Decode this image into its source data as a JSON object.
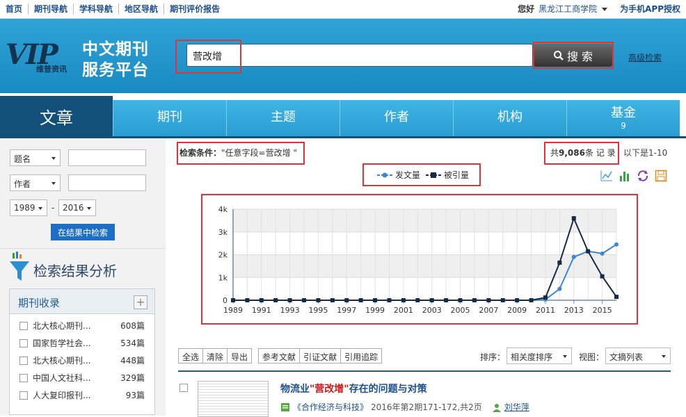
{
  "topbar": {
    "links": [
      "首页",
      "期刊导航",
      "学科导航",
      "地区导航",
      "期刊评价报告"
    ],
    "greeting": "您好",
    "institution": "黑龙江工商学院",
    "app_link": "为手机APP授权"
  },
  "header": {
    "logo_text": "VIP",
    "logo_sub": "维普资讯",
    "brand_line1": "中文期刊",
    "brand_line2": "服务平台",
    "search_value": "营改增",
    "search_button": "搜 索",
    "advanced_link": "高级检索"
  },
  "tabs": [
    {
      "label": "文章",
      "count": ""
    },
    {
      "label": "期刊",
      "count": ""
    },
    {
      "label": "主题",
      "count": ""
    },
    {
      "label": "作者",
      "count": ""
    },
    {
      "label": "机构",
      "count": ""
    },
    {
      "label": "基金",
      "count": "9"
    }
  ],
  "sidebar": {
    "field1": "题名",
    "field2": "作者",
    "year_from": "1989",
    "year_to": "2016",
    "dash": "-",
    "search_in_results": "在结果中检索",
    "analysis_title": "检索结果分析",
    "panel_title": "期刊收录",
    "journals": [
      {
        "name": "北大核心期刊...",
        "count": "608篇"
      },
      {
        "name": "国家哲学社会...",
        "count": "534篇"
      },
      {
        "name": "北大核心期刊...",
        "count": "448篇"
      },
      {
        "name": "中国人文社科...",
        "count": "329篇"
      },
      {
        "name": "人大复印报刊...",
        "count": "93篇"
      }
    ]
  },
  "main": {
    "cond_label": "检索条件：",
    "cond_value": "\"任意字段=营改增 \"",
    "total_prefix": "共",
    "total_count": "9,086",
    "total_suffix": "条 记 录",
    "range": "以下是1-10",
    "legend_pub": "发文量",
    "legend_cite": "被引量",
    "toolbar": [
      "全选",
      "清除",
      "导出"
    ],
    "toolbar2": [
      "参考文献",
      "引证文献",
      "引用追踪"
    ],
    "sort_label": "排序：",
    "sort_value": "相关度排序",
    "view_label": "视图：",
    "view_value": "文摘列表",
    "result": {
      "title_before": "物流业",
      "title_hl": "\"营改增\"",
      "title_after": "存在的问题与对策",
      "source": "《合作经济与科技》",
      "meta": "2016年第2期171-172,共2页",
      "author": "刘华萍"
    }
  },
  "chart_data": {
    "type": "line",
    "x": [
      1989,
      1990,
      1991,
      1992,
      1993,
      1994,
      1995,
      1996,
      1997,
      1998,
      1999,
      2000,
      2001,
      2002,
      2003,
      2004,
      2005,
      2006,
      2007,
      2008,
      2009,
      2010,
      2011,
      2012,
      2013,
      2014,
      2015,
      2016
    ],
    "x_ticks": [
      "1989",
      "1991",
      "1993",
      "1995",
      "1997",
      "1999",
      "2001",
      "2003",
      "2005",
      "2007",
      "2009",
      "2011",
      "2013",
      "2015"
    ],
    "y_ticks": [
      "0",
      "1k",
      "2k",
      "3k",
      "4k"
    ],
    "ylim": [
      0,
      4000
    ],
    "series": [
      {
        "name": "发文量",
        "color": "#3a86d4",
        "values": [
          0,
          0,
          0,
          0,
          0,
          0,
          0,
          0,
          0,
          0,
          0,
          0,
          0,
          0,
          0,
          0,
          0,
          0,
          0,
          0,
          0,
          0,
          30,
          500,
          1900,
          2150,
          2050,
          2450
        ]
      },
      {
        "name": "被引量",
        "color": "#162a45",
        "values": [
          0,
          0,
          0,
          0,
          0,
          0,
          0,
          0,
          0,
          0,
          0,
          0,
          0,
          0,
          0,
          0,
          0,
          0,
          0,
          0,
          0,
          0,
          120,
          1650,
          3600,
          2150,
          1050,
          150
        ]
      }
    ],
    "grid": true
  }
}
